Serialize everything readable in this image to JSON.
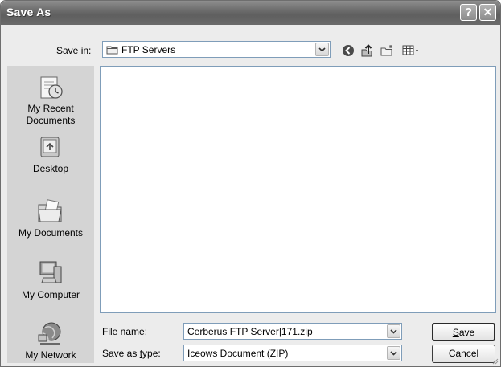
{
  "window": {
    "title": "Save As",
    "help_button": "?",
    "close_button": "✕"
  },
  "toolbar": {
    "save_in_label_pre": "Save ",
    "save_in_label_key": "i",
    "save_in_label_post": "n:",
    "save_in_value": "FTP Servers",
    "back_icon": "back-icon",
    "up_icon": "up-folder-icon",
    "new_folder_icon": "new-folder-icon",
    "view_menu_icon": "view-menu-icon"
  },
  "places": [
    {
      "id": "my-recent-documents",
      "label_line1": "My Recent",
      "label_line2": "Documents"
    },
    {
      "id": "desktop",
      "label_line1": "Desktop"
    },
    {
      "id": "my-documents",
      "label_line1": "My Documents"
    },
    {
      "id": "my-computer",
      "label_line1": "My Computer"
    },
    {
      "id": "my-network",
      "label_line1": "My Network"
    }
  ],
  "file_list": {
    "items": []
  },
  "file_name": {
    "label_pre": "File ",
    "label_key": "n",
    "label_post": "ame:",
    "value": "Cerberus FTP Server|171.zip"
  },
  "save_type": {
    "label_pre": "Save as ",
    "label_key": "t",
    "label_post": "ype:",
    "value": "Iceows Document (ZIP)"
  },
  "buttons": {
    "save_key": "S",
    "save_rest": "ave",
    "cancel": "Cancel"
  },
  "colors": {
    "titlebar": "#6c6c6c",
    "dialog_bg": "#ececec",
    "places_bg": "#d4d4d4",
    "field_border": "#7f9db9"
  }
}
